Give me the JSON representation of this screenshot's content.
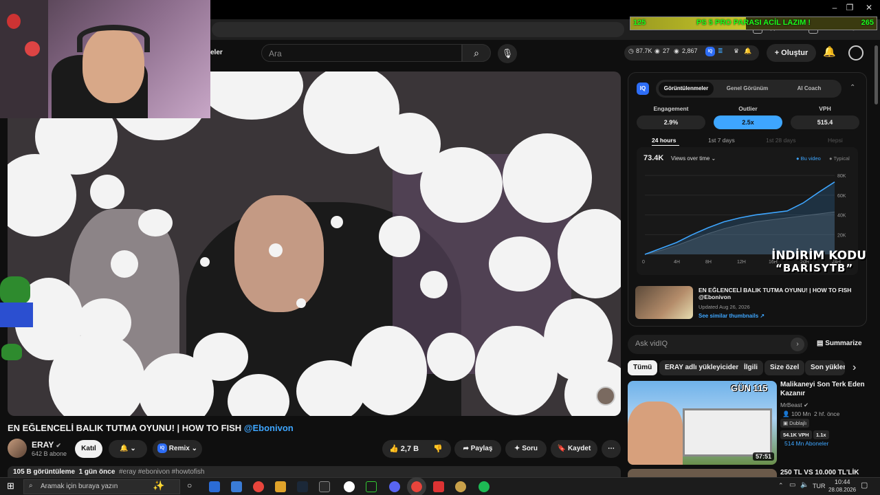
{
  "overlay": {
    "goal_left": "125",
    "goal_text": "PS 5 PRO PARASI ACİL LAZIM !",
    "goal_right": "265",
    "goal_progress": 0.47,
    "promo_line1": "İNDİRİM KODU",
    "promo_line2": "“BARISYTB”"
  },
  "header": {
    "search_placeholder": "Ara",
    "stats": {
      "views": "87.7K",
      "watching": "27",
      "visits": "2,867"
    },
    "create_label": "Oluştur",
    "nav_fragment": "eler"
  },
  "video": {
    "title": "EN EĞLENCELİ BALIK TUTMA OYUNU! | HOW TO FISH",
    "mention": "@Ebonivon",
    "channel": "ERAY",
    "subscribers": "642 B abone",
    "join_label": "Katıl",
    "remix_label": "Remix",
    "likes": "2,7 B",
    "share_label": "Paylaş",
    "ask_label": "Soru",
    "save_label": "Kaydet",
    "views": "105 B görüntüleme",
    "age": "1 gün önce",
    "tags": "#eray #ebonivon #howtofish"
  },
  "vidiq": {
    "badge": "IQ",
    "tabs": [
      "Görüntülenmeler",
      "Genel Görünüm",
      "AI Coach"
    ],
    "metrics": [
      {
        "label": "Engagement",
        "value": "2.9%"
      },
      {
        "label": "Outlier",
        "value": "2.5x"
      },
      {
        "label": "VPH",
        "value": "515.4"
      }
    ],
    "ranges": [
      "24 hours",
      "1st 7 days",
      "1st 28 days",
      "Hepsi"
    ],
    "current_views": "73.4K",
    "views_dropdown": "Views over time",
    "legend": {
      "this_video": "Bu video",
      "typical": "Typical"
    },
    "video_title": "EN EĞLENCELİ BALIK TUTMA OYUNU! | HOW TO FISH @Ebonivon",
    "updated": "Updated Aug 26, 2026",
    "similar": "See similar thumbnails",
    "ask_placeholder": "Ask vidIQ",
    "summarize_label": "Summarize"
  },
  "chart_data": {
    "type": "area",
    "x": [
      0,
      2,
      4,
      6,
      8,
      10,
      12,
      14,
      16,
      18,
      20,
      22,
      24
    ],
    "x_tick_labels": [
      "0",
      "4H",
      "8H",
      "12H",
      "16H",
      "20H",
      "24H"
    ],
    "y_tick_labels": [
      "20K",
      "40K",
      "60K",
      "80K"
    ],
    "ylim": [
      0,
      85000
    ],
    "series": [
      {
        "name": "Bu video",
        "values": [
          0,
          6000,
          12000,
          20000,
          27000,
          33000,
          37000,
          40000,
          42000,
          44000,
          52000,
          63000,
          73400
        ]
      },
      {
        "name": "Typical",
        "values": [
          0,
          4000,
          9000,
          15000,
          21000,
          26000,
          30000,
          33000,
          35000,
          37000,
          39000,
          41000,
          43000
        ]
      }
    ]
  },
  "chips": [
    "Tümü",
    "ERAY adlı yükleyiciden",
    "İlgili",
    "Size özel",
    "Son yüklen"
  ],
  "recommendations": [
    {
      "title": "Malikaneyi Son Terk Eden Kazanır",
      "channel": "MrBeast",
      "views": "100 Mn",
      "age": "2 hf. önce",
      "dubbed": "Dublajlı",
      "vph": "54.1K VPH",
      "outlier": "1.1x",
      "subs": "514 Mn Aboneler",
      "duration": "57:51",
      "thumb_text": "GÜN 115"
    },
    {
      "title": "250 TL VS 10.000 TL'LİK"
    }
  ],
  "taskbar": {
    "search_placeholder": "Aramak için buraya yazın",
    "lang": "TUR",
    "time": "10:44",
    "date": "28.08.2026"
  }
}
